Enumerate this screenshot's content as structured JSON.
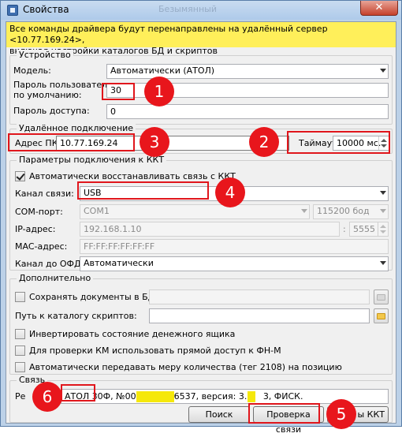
{
  "window": {
    "title": "Свойства",
    "close_glyph": "✕",
    "ghost_tab": "Безымянный"
  },
  "banner": {
    "line1": "Все команды драйвера будут перенаправлены на удалённый сервер <10.77.169.24>,",
    "line2": "включая настройки каталогов БД и скриптов"
  },
  "device": {
    "title": "Устройство",
    "model_label": "Модель:",
    "model_value": "Автоматически (АТОЛ)",
    "user_password_label_1": "Пароль пользователя",
    "user_password_label_2": "по умолчанию:",
    "user_password_value": "30",
    "access_password_label": "Пароль доступа:",
    "access_password_value": "0"
  },
  "remote": {
    "title": "Удалённое подключение",
    "address_label": "Адрес ПК:",
    "address_value": "10.77.169.24",
    "timeout_label": "Таймаут",
    "timeout_value": "10000 мс."
  },
  "connection": {
    "title": "Параметры подключения к ККТ",
    "auto_restore_label": "Автоматически восстанавливать связь с ККТ",
    "auto_restore_checked": true,
    "channel_label": "Канал связи:",
    "channel_value": "USB",
    "com_label": "COM-порт:",
    "com_value": "COM1",
    "baud_value": "115200 бод",
    "ip_label": "IP-адрес:",
    "ip_value": "192.168.1.10",
    "port_separator": ":",
    "port_value": "5555",
    "mac_label": "MAC-адрес:",
    "mac_value": "FF:FF:FF:FF:FF:FF",
    "ofd_label": "Канал до ОФД:",
    "ofd_value": "Автоматически"
  },
  "extra": {
    "title": "Дополнительно",
    "save_docs_label": "Сохранять документы в БД",
    "scripts_path_label": "Путь к каталогу скриптов:",
    "invert_drawer_label": "Инвертировать состояние денежного ящика",
    "km_direct_label": "Для проверки КМ использовать прямой доступ к ФН-М",
    "quantity_tag_label": "Автоматически передавать меру количества (тег 2108) на позицию"
  },
  "link": {
    "title": "Связь",
    "result_label": "Ре",
    "result_part1": "АТОЛ 30",
    "result_part2": "Ф, №00",
    "result_part3": "6537, версия: 3.0.",
    "result_part4": "3, ФИСК.",
    "search_button": "Поиск",
    "check_button": "Проверка связи",
    "kkt_params_button": "ы ККТ"
  },
  "annotations": {
    "badge1": "1",
    "badge2": "2",
    "badge3": "3",
    "badge4": "4",
    "badge5": "5",
    "badge6": "6"
  },
  "icons": {
    "app": "properties-window-icon",
    "close": "close-icon",
    "folder": "folder-icon",
    "dropdown": "chevron-down-icon",
    "spin": "spin-arrows-icon"
  },
  "colors": {
    "banner": "#ffef5a",
    "annotation_red": "#e8161c",
    "redaction_yellow": "#f5e80b",
    "close_red": "#c5412b"
  }
}
